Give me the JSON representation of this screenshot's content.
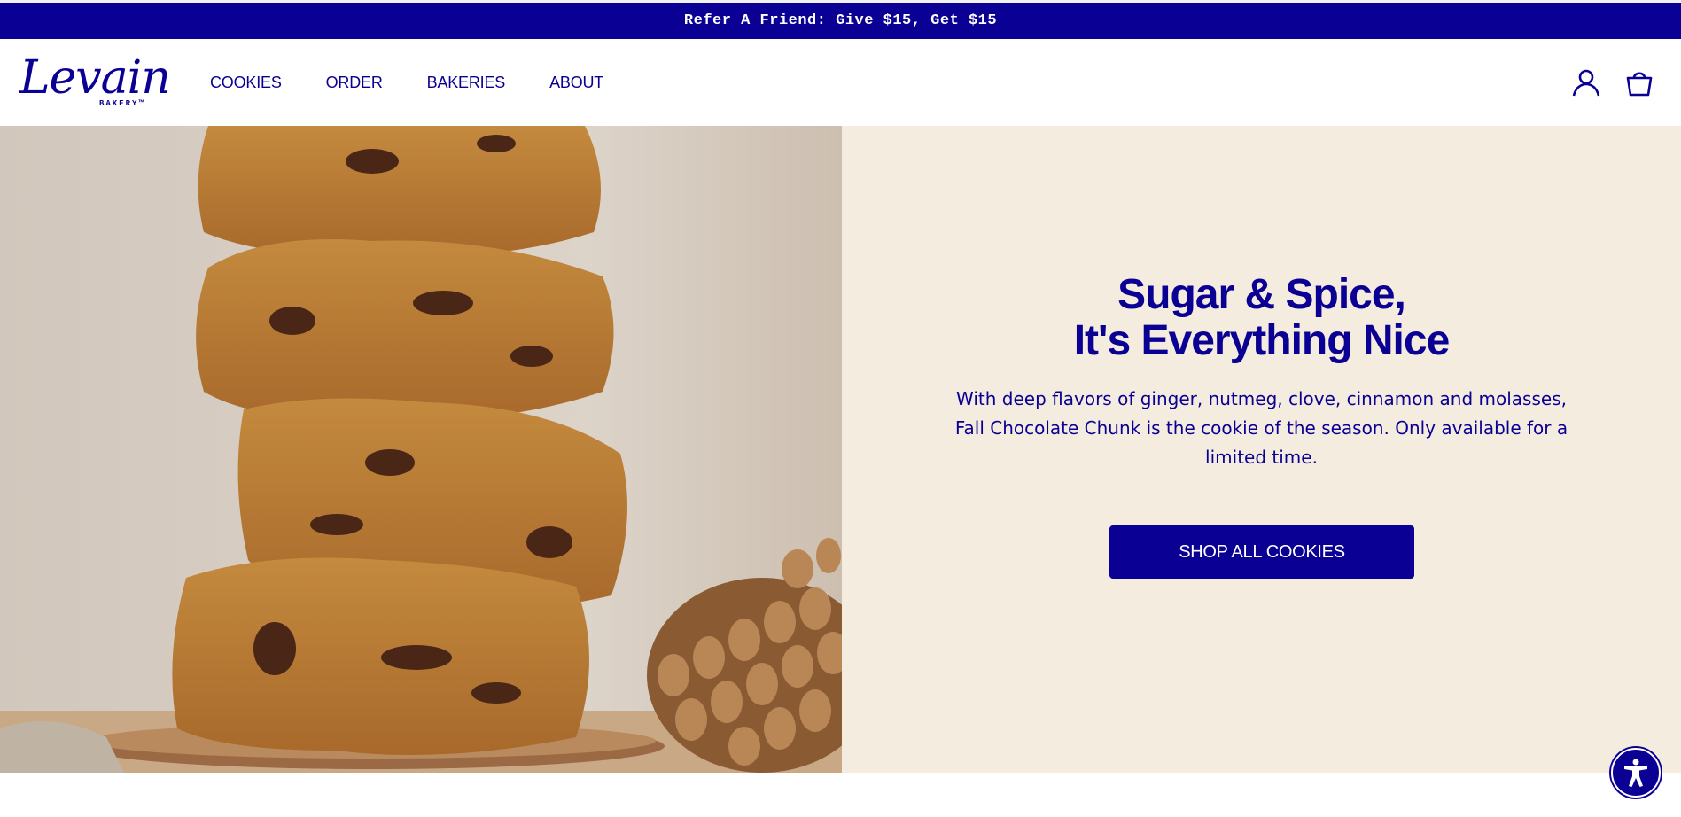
{
  "promo": {
    "text": "Refer A Friend: Give $15, Get $15"
  },
  "brand": {
    "logo_text": "Levain",
    "logo_sub": "BAKERY™"
  },
  "nav": {
    "items": [
      "COOKIES",
      "ORDER",
      "BAKERIES",
      "ABOUT"
    ]
  },
  "header_icons": {
    "account": "user-icon",
    "cart": "shopping-bag-icon"
  },
  "hero": {
    "headline_line1": "Sugar & Spice,",
    "headline_line2": "It's Everything Nice",
    "body": "With deep flavors of ginger, nutmeg, clove, cinnamon and molasses, Fall Chocolate Chunk is the cookie of the season. Only available for a limited time.",
    "cta_label": "SHOP ALL COOKIES"
  },
  "accessibility": {
    "icon": "accessibility-icon"
  },
  "colors": {
    "brand_blue": "#0b0094",
    "panel_cream": "#f5ece0",
    "white": "#ffffff"
  }
}
